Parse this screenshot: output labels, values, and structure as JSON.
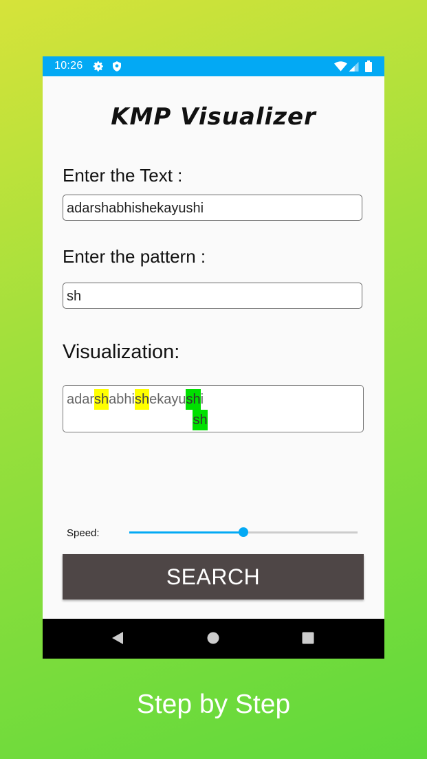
{
  "statusbar": {
    "time": "10:26",
    "icons": [
      "gear-icon",
      "shield-icon",
      "wifi-icon",
      "cell-signal-icon",
      "battery-icon"
    ]
  },
  "app": {
    "title": "KMP Visualizer",
    "text_label": "Enter the Text :",
    "text_value": "adarshabhishekayushi",
    "pattern_label": "Enter the pattern :",
    "pattern_value": "sh",
    "viz_label": "Visualization:",
    "viz": {
      "row1": [
        {
          "text": "adar",
          "hl": "none"
        },
        {
          "text": "sh",
          "hl": "yellow"
        },
        {
          "text": "abhi",
          "hl": "none"
        },
        {
          "text": "sh",
          "hl": "yellow"
        },
        {
          "text": "ekayu",
          "hl": "none"
        },
        {
          "text": "sh",
          "hl": "green"
        },
        {
          "text": "i",
          "hl": "none"
        }
      ],
      "row2_pattern": "sh",
      "row2_offset_chars": 18
    },
    "speed_label": "Speed:",
    "speed_fraction": 0.5,
    "search_button": "SEARCH"
  },
  "navbar": {
    "back": "back-icon",
    "home": "home-icon",
    "recents": "recents-icon"
  },
  "caption": "Step by Step",
  "colors": {
    "accent": "#03a9f4",
    "button": "#4e4646",
    "match": "#ffff00",
    "current": "#00e000"
  }
}
